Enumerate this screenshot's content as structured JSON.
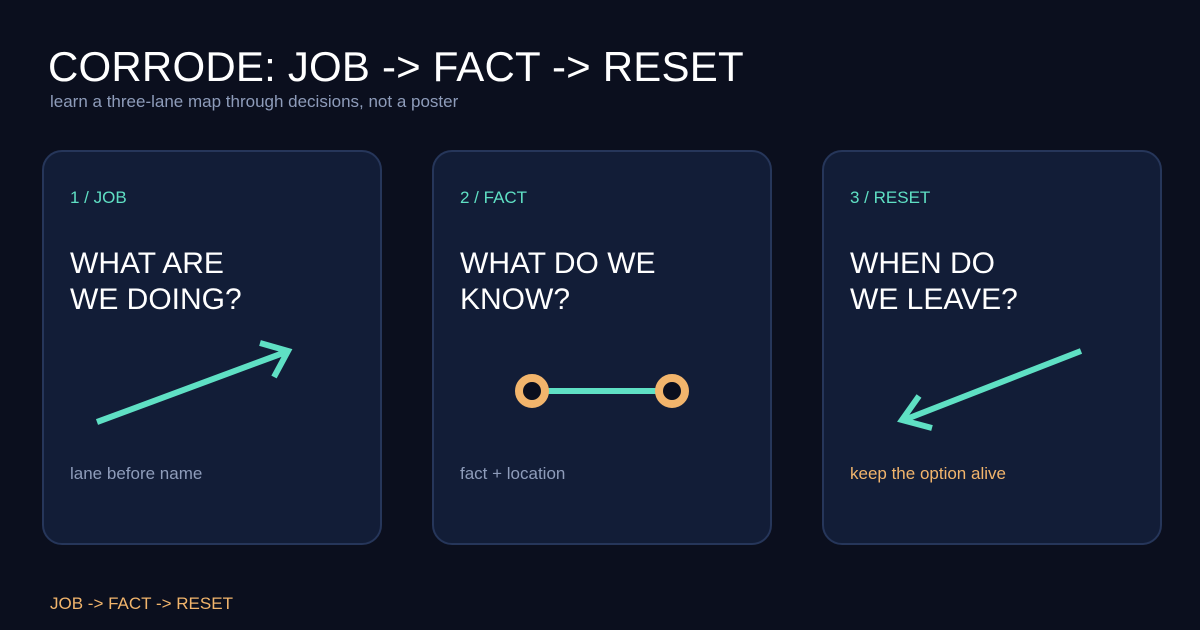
{
  "header": {
    "title": "CORRODE: JOB -> FACT -> RESET",
    "subtitle": "learn a three-lane map through decisions, not a poster"
  },
  "cards": [
    {
      "step": "1 / JOB",
      "question_line1": "WHAT ARE",
      "question_line2": "WE DOING?",
      "caption": "lane before name",
      "icon": "arrow-up-right-icon"
    },
    {
      "step": "2 / FACT",
      "question_line1": "WHAT DO WE",
      "question_line2": "KNOW?",
      "caption": "fact + location",
      "icon": "connected-nodes-icon"
    },
    {
      "step": "3 / RESET",
      "question_line1": "WHEN DO",
      "question_line2": "WE LEAVE?",
      "caption": "keep the option alive",
      "icon": "arrow-down-left-icon"
    }
  ],
  "footer": {
    "text": "JOB -> FACT -> RESET"
  },
  "colors": {
    "background": "#0b0f1e",
    "card": "#121d37",
    "card_border": "#26365a",
    "teal_accent": "#5fe0c4",
    "orange_accent": "#f2b56c",
    "muted_text": "#8e9cba"
  }
}
